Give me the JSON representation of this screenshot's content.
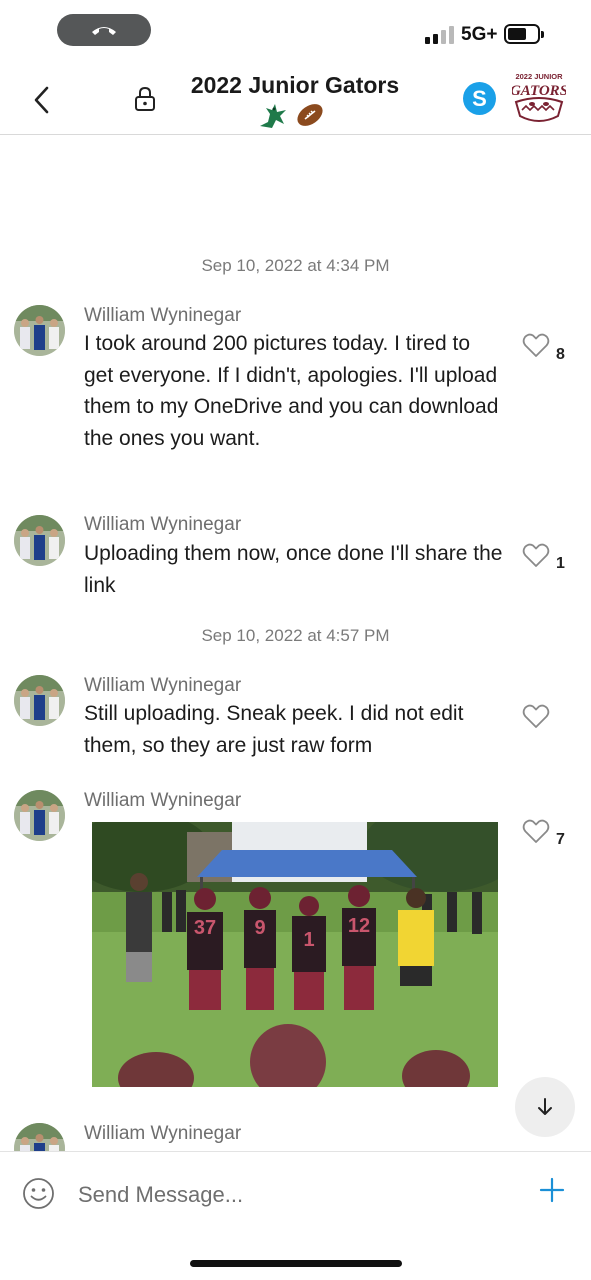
{
  "status_bar": {
    "network": "5G+",
    "signal_bars": 4,
    "signal_bars_active": 2,
    "battery_level": 0.6
  },
  "header": {
    "title": "2022 Junior Gators",
    "title_emoji": [
      "🐊",
      "🏈"
    ],
    "group_logo_text": "2022 JUNIOR GATORS",
    "icons": [
      "back-icon",
      "lock-icon",
      "skype-icon",
      "group-logo"
    ]
  },
  "feed": [
    {
      "type": "timestamp",
      "text": "Sep 10, 2022 at 4:34 PM"
    },
    {
      "type": "message",
      "sender": "William Wyninegar",
      "text": "I took around 200 pictures today. I tired to get everyone. If I didn't, apologies. I'll upload them to my OneDrive and you can download the ones you want.",
      "likes": "8"
    },
    {
      "type": "message",
      "sender": "William Wyninegar",
      "text": "Uploading them now, once done I'll share the link",
      "likes": "1"
    },
    {
      "type": "timestamp",
      "text": "Sep 10, 2022 at 4:57 PM"
    },
    {
      "type": "message",
      "sender": "William Wyninegar",
      "text": "Still uploading. Sneak peek. I did not edit them, so they are just raw form",
      "likes": ""
    },
    {
      "type": "photo",
      "sender": "William Wyninegar",
      "likes": "7",
      "jersey_numbers": [
        "37",
        "9",
        "1",
        "12"
      ]
    },
    {
      "type": "message",
      "sender": "William Wyninegar",
      "text": "",
      "likes": ""
    }
  ],
  "composer": {
    "placeholder": "Send Message...",
    "icons": [
      "emoji-icon",
      "plus-icon"
    ]
  },
  "colors": {
    "accent": "#1a8fd6",
    "timestamp": "#7a7a7a",
    "maroon": "#7a2232",
    "skype": "#1aa0e8"
  }
}
